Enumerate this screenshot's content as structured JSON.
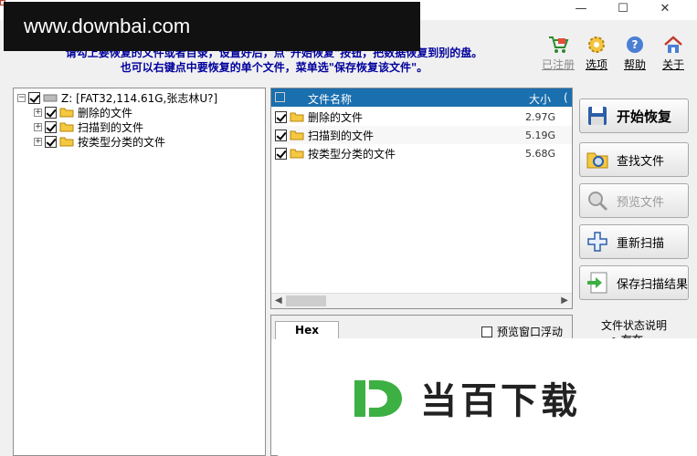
{
  "window": {
    "minimize": "—",
    "maximize": "☐",
    "close": "✕"
  },
  "watermark": "www.downbai.com",
  "instructions": {
    "line1": "请勾上要恢复的文件或者目录，设置好后，点\"开始恢复\"按钮，把数据恢复到别的盘。",
    "line2": "也可以右键点中要恢复的单个文件，菜单选\"保存恢复该文件\"。"
  },
  "top_icons": [
    {
      "label": "已注册",
      "icon": "cart-icon",
      "disabled": true
    },
    {
      "label": "选项",
      "icon": "gear-icon",
      "disabled": false
    },
    {
      "label": "帮助",
      "icon": "help-icon",
      "disabled": false
    },
    {
      "label": "关于",
      "icon": "home-icon",
      "disabled": false
    }
  ],
  "tree": {
    "root": "Z:  [FAT32,114.61G,张志林U?]",
    "children": [
      {
        "label": "删除的文件"
      },
      {
        "label": "扫描到的文件"
      },
      {
        "label": "按类型分类的文件"
      }
    ]
  },
  "file_list": {
    "columns": {
      "name": "文件名称",
      "size": "大小",
      "extra": "("
    },
    "rows": [
      {
        "name": "删除的文件",
        "size": "2.97G"
      },
      {
        "name": "扫描到的文件",
        "size": "5.19G"
      },
      {
        "name": "按类型分类的文件",
        "size": "5.68G"
      }
    ]
  },
  "buttons": {
    "start_recovery": "开始恢复",
    "find_file": "查找文件",
    "preview_file": "预览文件",
    "rescan": "重新扫描",
    "save_scan": "保存扫描结果"
  },
  "preview": {
    "hex_tab": "Hex",
    "float_option": "预览窗口浮动"
  },
  "status": {
    "label": "文件状态说明",
    "sub": "• 存在"
  },
  "logo": {
    "text": "当百下载",
    "letter": "D"
  },
  "colors": {
    "header_blue": "#1a6fae",
    "instruction_blue": "#00009c",
    "logo_green": "#3cb043"
  }
}
